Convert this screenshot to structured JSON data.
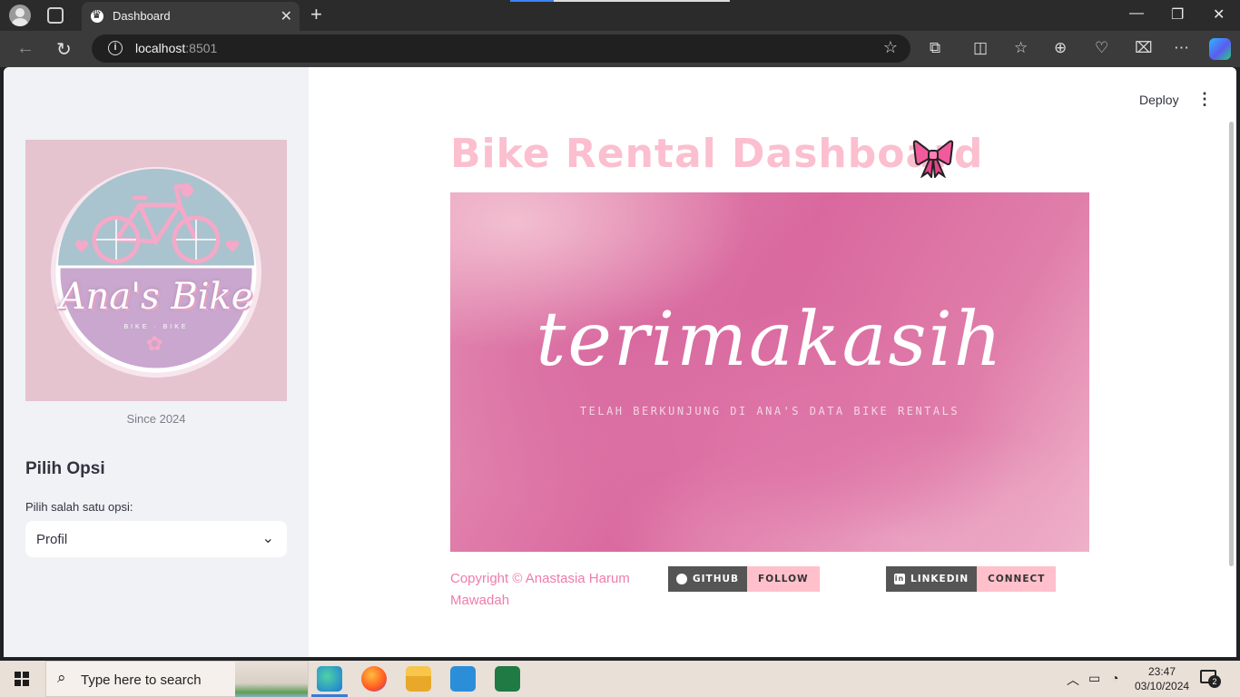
{
  "browser": {
    "tab_title": "Dashboard",
    "url_host": "localhost",
    "url_port": ":8501"
  },
  "sidebar": {
    "logo_text": "Ana's Bike",
    "logo_small_text": "BIKE · BIKE",
    "caption": "Since 2024",
    "heading": "Pilih Opsi",
    "select_label": "Pilih salah satu opsi:",
    "select_value": "Profil"
  },
  "toolbar": {
    "deploy_label": "Deploy"
  },
  "main": {
    "title": "Bike Rental Dashboard",
    "banner_script": "terimakasih",
    "banner_sub": "TELAH BERKUNJUNG DI ANA'S DATA BIKE RENTALS",
    "copyright": "Copyright © Anastasia Harum Mawadah",
    "github_left": "GITHUB",
    "github_right": "FOLLOW",
    "linkedin_left": "LINKEDIN",
    "linkedin_right": "CONNECT"
  },
  "taskbar": {
    "search_placeholder": "Type here to search",
    "time": "23:47",
    "date": "03/10/2024",
    "notification_count": "2"
  },
  "colors": {
    "title_pink": "#fbbfcf",
    "copyright_pink": "#ef7cac",
    "badge_pink": "#ffc0cb",
    "sidebar_bg": "#f0f2f6"
  }
}
